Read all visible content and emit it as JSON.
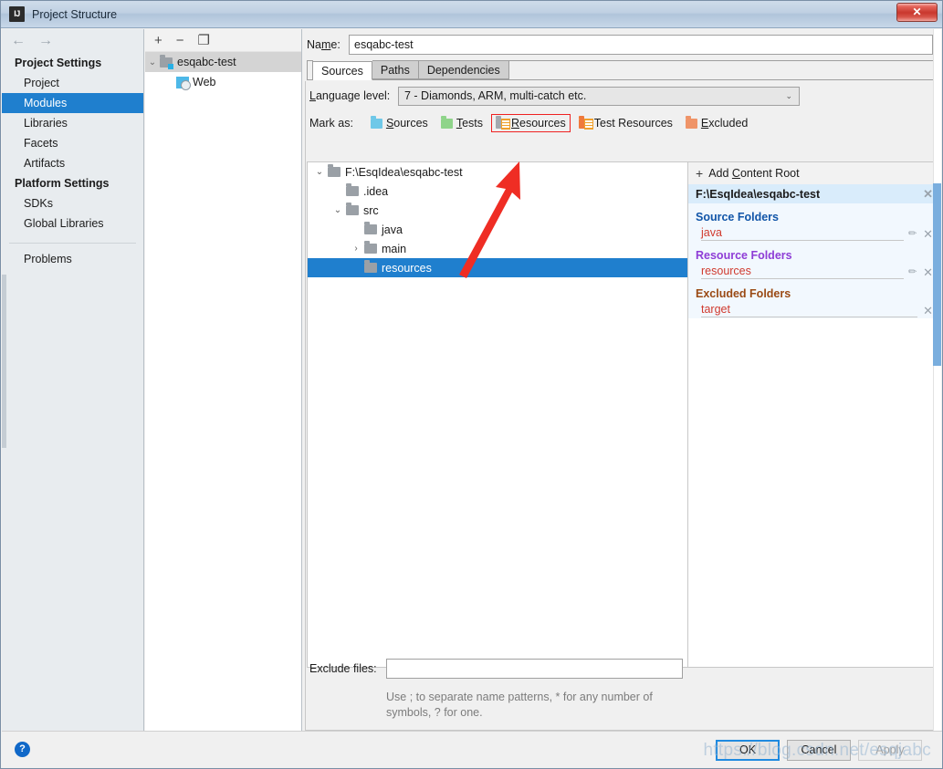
{
  "window": {
    "title": "Project Structure",
    "logo_text": "IJ",
    "close_label": "✕"
  },
  "sidebar": {
    "back_icon": "←",
    "forward_icon": "→",
    "groups": [
      {
        "label": "Project Settings"
      },
      {
        "label": "Platform Settings"
      }
    ],
    "items": [
      {
        "label": "Project",
        "selected": false
      },
      {
        "label": "Modules",
        "selected": true
      },
      {
        "label": "Libraries",
        "selected": false
      },
      {
        "label": "Facets",
        "selected": false
      },
      {
        "label": "Artifacts",
        "selected": false
      }
    ],
    "platform_items": [
      {
        "label": "SDKs"
      },
      {
        "label": "Global Libraries"
      }
    ],
    "problems": "Problems"
  },
  "modules": {
    "toolbar": {
      "add": "+",
      "remove": "−",
      "copy": "❐"
    },
    "tree": [
      {
        "label": "esqabc-test",
        "twisty": "⌄",
        "icon": "module-folder-icon",
        "selected": true,
        "indent": 0
      },
      {
        "label": "Web",
        "twisty": "",
        "icon": "web-facet-icon",
        "selected": false,
        "indent": 1
      }
    ]
  },
  "editor": {
    "name_label_pre": "Na",
    "name_label_mnemonic": "m",
    "name_label_post": "e:",
    "name_value": "esqabc-test",
    "name_placeholder": "",
    "tabs": [
      {
        "label": "Sources",
        "active": true
      },
      {
        "label": "Paths",
        "active": false
      },
      {
        "label": "Dependencies",
        "active": false
      }
    ],
    "language_level": {
      "label_pre": "L",
      "label_mnemonic": "",
      "label": "Language level:",
      "value": "7 - Diamonds, ARM, multi-catch etc.",
      "chevron": "⌄"
    },
    "mark_as": {
      "label": "Mark as:",
      "options": [
        {
          "label": "Sources",
          "mnemonic": "S",
          "rest": "ources",
          "icon": "folder-sources-icon",
          "color": "blue",
          "highlighted": false
        },
        {
          "label": "Tests",
          "mnemonic": "T",
          "rest": "ests",
          "icon": "folder-tests-icon",
          "color": "green",
          "highlighted": false
        },
        {
          "label": "Resources",
          "mnemonic": "R",
          "rest": "esources",
          "icon": "folder-resources-icon",
          "color": "gray",
          "highlighted": true
        },
        {
          "label": "Test Resources",
          "mnemonic": "",
          "rest": "Test Resources",
          "icon": "folder-test-resources-icon",
          "color": "testres",
          "highlighted": false
        },
        {
          "label": "Excluded",
          "mnemonic": "E",
          "rest": "xcluded",
          "icon": "folder-excluded-icon",
          "color": "orange",
          "highlighted": false
        }
      ]
    },
    "file_tree": [
      {
        "label": "F:\\EsqIdea\\esqabc-test",
        "twisty": "⌄",
        "indent": 0,
        "selected": false
      },
      {
        "label": ".idea",
        "twisty": "",
        "indent": 1,
        "selected": false
      },
      {
        "label": "src",
        "twisty": "⌄",
        "indent": 1,
        "selected": false
      },
      {
        "label": "java",
        "twisty": "",
        "indent": 2,
        "selected": false
      },
      {
        "label": "main",
        "twisty": "›",
        "indent": 2,
        "selected": false
      },
      {
        "label": "resources",
        "twisty": "",
        "indent": 2,
        "selected": true
      }
    ],
    "content_roots": {
      "add_label_pre": "Add ",
      "add_mnemonic": "C",
      "add_label_post": "ontent Root",
      "plus": "+",
      "root_path": "F:\\EsqIdea\\esqabc-test",
      "close_icon": "✕",
      "pencil_icon": "✎",
      "sections": [
        {
          "title": "Source Folders",
          "kind": "src",
          "items": [
            {
              "name": "java",
              "has_pencil": true
            }
          ]
        },
        {
          "title": "Resource Folders",
          "kind": "res",
          "items": [
            {
              "name": "resources",
              "has_pencil": true
            }
          ]
        },
        {
          "title": "Excluded Folders",
          "kind": "exc",
          "items": [
            {
              "name": "target",
              "has_pencil": false
            }
          ]
        }
      ]
    },
    "exclude_files": {
      "label": "Exclude files:",
      "value": "",
      "placeholder": "",
      "hint": "Use ; to separate name patterns, * for any number of symbols, ? for one."
    }
  },
  "bottom": {
    "help_icon": "?",
    "ok": "OK",
    "cancel": "Cancel",
    "apply": "Apply"
  },
  "watermark": "https://blog.csdn.net/esqjabc",
  "colors": {
    "selection_blue": "#1f7fce",
    "annotation_red": "#ef2d24",
    "title_bar": "#bfd0e2"
  }
}
